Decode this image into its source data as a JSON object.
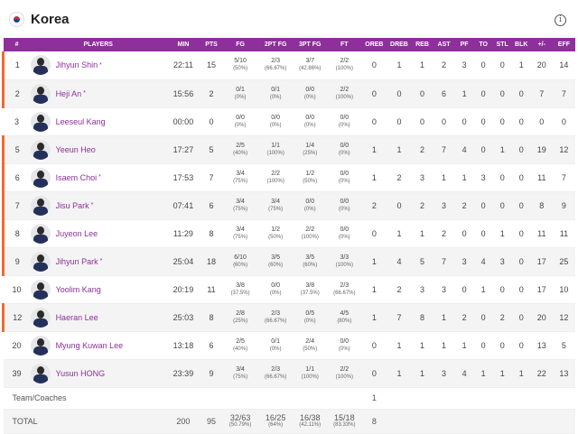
{
  "team": {
    "name": "Korea",
    "info_icon": "info-icon"
  },
  "columns": [
    "#",
    "PLAYERS",
    "MIN",
    "PTS",
    "FG",
    "2PT FG",
    "3PT FG",
    "FT",
    "OREB",
    "DREB",
    "REB",
    "AST",
    "PF",
    "TO",
    "STL",
    "BLK",
    "+/-",
    "EFF"
  ],
  "players": [
    {
      "num": "1",
      "name": "Jihyun Shin",
      "starter": true,
      "min": "22:11",
      "pts": "15",
      "fg": "5/10",
      "fg_pct": "(50%)",
      "fg2": "2/3",
      "fg2_pct": "(66.67%)",
      "fg3": "3/7",
      "fg3_pct": "(42.86%)",
      "ft": "2/2",
      "ft_pct": "(100%)",
      "oreb": "0",
      "dreb": "1",
      "reb": "1",
      "ast": "2",
      "pf": "3",
      "to": "0",
      "stl": "0",
      "blk": "1",
      "pm": "20",
      "eff": "14"
    },
    {
      "num": "2",
      "name": "Heji An",
      "starter": true,
      "min": "15:56",
      "pts": "2",
      "fg": "0/1",
      "fg_pct": "(0%)",
      "fg2": "0/1",
      "fg2_pct": "(0%)",
      "fg3": "0/0",
      "fg3_pct": "(0%)",
      "ft": "2/2",
      "ft_pct": "(100%)",
      "oreb": "0",
      "dreb": "0",
      "reb": "0",
      "ast": "6",
      "pf": "1",
      "to": "0",
      "stl": "0",
      "blk": "0",
      "pm": "7",
      "eff": "7"
    },
    {
      "num": "3",
      "name": "Leeseul Kang",
      "starter": false,
      "min": "00:00",
      "pts": "0",
      "fg": "0/0",
      "fg_pct": "(0%)",
      "fg2": "0/0",
      "fg2_pct": "(0%)",
      "fg3": "0/0",
      "fg3_pct": "(0%)",
      "ft": "0/0",
      "ft_pct": "(0%)",
      "oreb": "0",
      "dreb": "0",
      "reb": "0",
      "ast": "0",
      "pf": "0",
      "to": "0",
      "stl": "0",
      "blk": "0",
      "pm": "0",
      "eff": "0"
    },
    {
      "num": "5",
      "name": "Yeeun Heo",
      "starter": false,
      "min": "17:27",
      "pts": "5",
      "fg": "2/5",
      "fg_pct": "(40%)",
      "fg2": "1/1",
      "fg2_pct": "(100%)",
      "fg3": "1/4",
      "fg3_pct": "(25%)",
      "ft": "0/0",
      "ft_pct": "(0%)",
      "oreb": "1",
      "dreb": "1",
      "reb": "2",
      "ast": "7",
      "pf": "4",
      "to": "0",
      "stl": "1",
      "blk": "0",
      "pm": "19",
      "eff": "12"
    },
    {
      "num": "6",
      "name": "Isaem Choi",
      "starter": true,
      "min": "17:53",
      "pts": "7",
      "fg": "3/4",
      "fg_pct": "(75%)",
      "fg2": "2/2",
      "fg2_pct": "(100%)",
      "fg3": "1/2",
      "fg3_pct": "(50%)",
      "ft": "0/0",
      "ft_pct": "(0%)",
      "oreb": "1",
      "dreb": "2",
      "reb": "3",
      "ast": "1",
      "pf": "1",
      "to": "3",
      "stl": "0",
      "blk": "0",
      "pm": "11",
      "eff": "7"
    },
    {
      "num": "7",
      "name": "Jisu Park",
      "starter": true,
      "min": "07:41",
      "pts": "6",
      "fg": "3/4",
      "fg_pct": "(75%)",
      "fg2": "3/4",
      "fg2_pct": "(75%)",
      "fg3": "0/0",
      "fg3_pct": "(0%)",
      "ft": "0/0",
      "ft_pct": "(0%)",
      "oreb": "2",
      "dreb": "0",
      "reb": "2",
      "ast": "3",
      "pf": "2",
      "to": "0",
      "stl": "0",
      "blk": "0",
      "pm": "8",
      "eff": "9"
    },
    {
      "num": "8",
      "name": "Juyeon Lee",
      "starter": false,
      "min": "11:29",
      "pts": "8",
      "fg": "3/4",
      "fg_pct": "(75%)",
      "fg2": "1/2",
      "fg2_pct": "(50%)",
      "fg3": "2/2",
      "fg3_pct": "(100%)",
      "ft": "0/0",
      "ft_pct": "(0%)",
      "oreb": "0",
      "dreb": "1",
      "reb": "1",
      "ast": "2",
      "pf": "0",
      "to": "0",
      "stl": "1",
      "blk": "0",
      "pm": "11",
      "eff": "11"
    },
    {
      "num": "9",
      "name": "Jihyun Park",
      "starter": true,
      "min": "25:04",
      "pts": "18",
      "fg": "6/10",
      "fg_pct": "(60%)",
      "fg2": "3/5",
      "fg2_pct": "(60%)",
      "fg3": "3/5",
      "fg3_pct": "(60%)",
      "ft": "3/3",
      "ft_pct": "(100%)",
      "oreb": "1",
      "dreb": "4",
      "reb": "5",
      "ast": "7",
      "pf": "3",
      "to": "4",
      "stl": "3",
      "blk": "0",
      "pm": "17",
      "eff": "25"
    },
    {
      "num": "10",
      "name": "Yoolim Kang",
      "starter": false,
      "min": "20:19",
      "pts": "11",
      "fg": "3/8",
      "fg_pct": "(37.5%)",
      "fg2": "0/0",
      "fg2_pct": "(0%)",
      "fg3": "3/8",
      "fg3_pct": "(37.5%)",
      "ft": "2/3",
      "ft_pct": "(66.67%)",
      "oreb": "1",
      "dreb": "2",
      "reb": "3",
      "ast": "3",
      "pf": "0",
      "to": "1",
      "stl": "0",
      "blk": "0",
      "pm": "17",
      "eff": "10"
    },
    {
      "num": "12",
      "name": "Haeran Lee",
      "starter": false,
      "min": "25:03",
      "pts": "8",
      "fg": "2/8",
      "fg_pct": "(25%)",
      "fg2": "2/3",
      "fg2_pct": "(66.67%)",
      "fg3": "0/5",
      "fg3_pct": "(0%)",
      "ft": "4/5",
      "ft_pct": "(80%)",
      "oreb": "1",
      "dreb": "7",
      "reb": "8",
      "ast": "1",
      "pf": "2",
      "to": "0",
      "stl": "2",
      "blk": "0",
      "pm": "20",
      "eff": "12"
    },
    {
      "num": "20",
      "name": "Myung Kuwan Lee",
      "starter": false,
      "min": "13:18",
      "pts": "6",
      "fg": "2/5",
      "fg_pct": "(40%)",
      "fg2": "0/1",
      "fg2_pct": "(0%)",
      "fg3": "2/4",
      "fg3_pct": "(50%)",
      "ft": "0/0",
      "ft_pct": "(0%)",
      "oreb": "0",
      "dreb": "1",
      "reb": "1",
      "ast": "1",
      "pf": "1",
      "to": "0",
      "stl": "0",
      "blk": "0",
      "pm": "13",
      "eff": "5"
    },
    {
      "num": "39",
      "name": "Yusun HONG",
      "starter": false,
      "min": "23:39",
      "pts": "9",
      "fg": "3/4",
      "fg_pct": "(75%)",
      "fg2": "2/3",
      "fg2_pct": "(66.67%)",
      "fg3": "1/1",
      "fg3_pct": "(100%)",
      "ft": "2/2",
      "ft_pct": "(100%)",
      "oreb": "0",
      "dreb": "1",
      "reb": "1",
      "ast": "3",
      "pf": "4",
      "to": "1",
      "stl": "1",
      "blk": "1",
      "pm": "22",
      "eff": "13"
    }
  ],
  "team_row": {
    "label": "Team/Coaches",
    "oreb": "1"
  },
  "total_row": {
    "label": "TOTAL",
    "min": "200",
    "pts": "95",
    "fg": "32/63",
    "fg_pct": "(50.79%)",
    "fg2": "16/25",
    "fg2_pct": "(64%)",
    "fg3": "16/38",
    "fg3_pct": "(42.11%)",
    "ft": "15/18",
    "ft_pct": "(83.33%)",
    "oreb": "8"
  },
  "starter_marker": "*",
  "colors": {
    "header": "#8e2f9b",
    "name": "#8e2f9b",
    "starter_bar": "#f26a2e"
  }
}
